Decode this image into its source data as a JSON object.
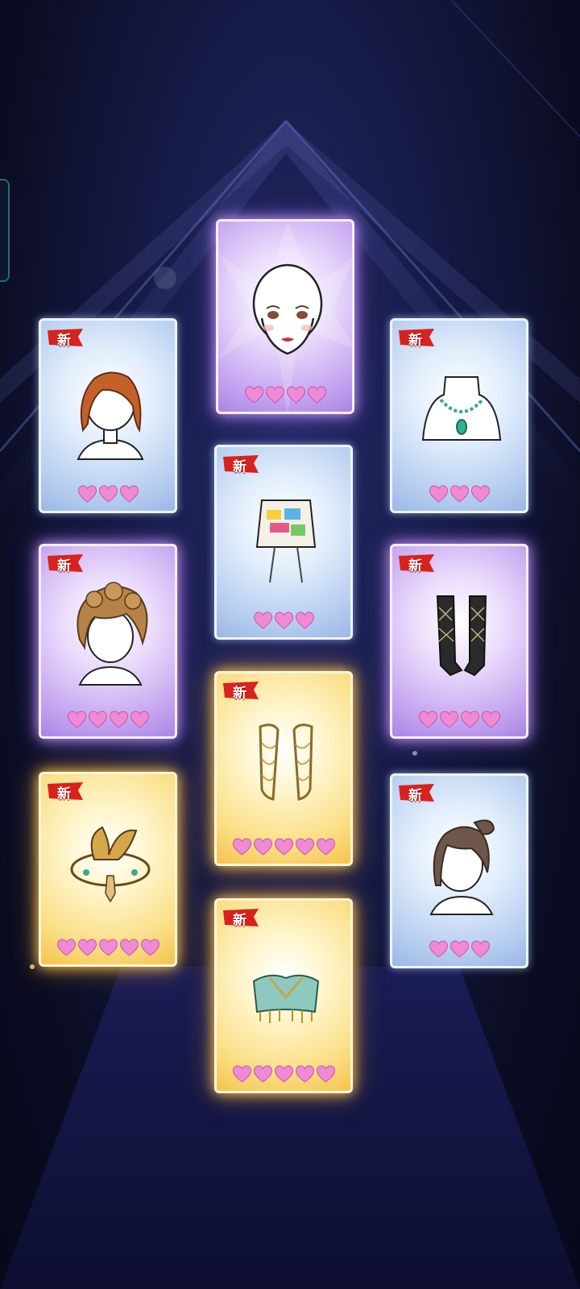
{
  "badge_text": "新",
  "colors": {
    "heart": "#f08ad6",
    "badge_red": "#d8221e",
    "card_blue": "#c4d8f4",
    "card_purple": "#c9a8f0",
    "card_gold": "#f9d66a"
  },
  "cards": [
    {
      "id": "face",
      "item": "face-icon",
      "rarity": "purple",
      "hearts": 4,
      "is_new": false
    },
    {
      "id": "short-wavy-hair",
      "item": "short-wavy-hair-icon",
      "rarity": "blue",
      "hearts": 3,
      "is_new": true
    },
    {
      "id": "jade-necklace",
      "item": "necklace-icon",
      "rarity": "blue",
      "hearts": 3,
      "is_new": true
    },
    {
      "id": "graffiti-top",
      "item": "graffiti-crop-top-icon",
      "rarity": "blue",
      "hearts": 3,
      "is_new": true
    },
    {
      "id": "curly-updo-hair",
      "item": "curly-updo-hair-icon",
      "rarity": "purple",
      "hearts": 4,
      "is_new": true
    },
    {
      "id": "argyle-socks",
      "item": "argyle-socks-icon",
      "rarity": "purple",
      "hearts": 4,
      "is_new": true
    },
    {
      "id": "chain-sleeves",
      "item": "pearl-chain-sleeves-icon",
      "rarity": "gold",
      "hearts": 5,
      "is_new": true
    },
    {
      "id": "gold-headpiece",
      "item": "gold-headpiece-icon",
      "rarity": "gold",
      "hearts": 5,
      "is_new": true
    },
    {
      "id": "ponytail-hair",
      "item": "ponytail-hair-icon",
      "rarity": "blue",
      "hearts": 3,
      "is_new": true
    },
    {
      "id": "jeweled-bandeau",
      "item": "jeweled-bandeau-top-icon",
      "rarity": "gold",
      "hearts": 5,
      "is_new": true
    }
  ]
}
